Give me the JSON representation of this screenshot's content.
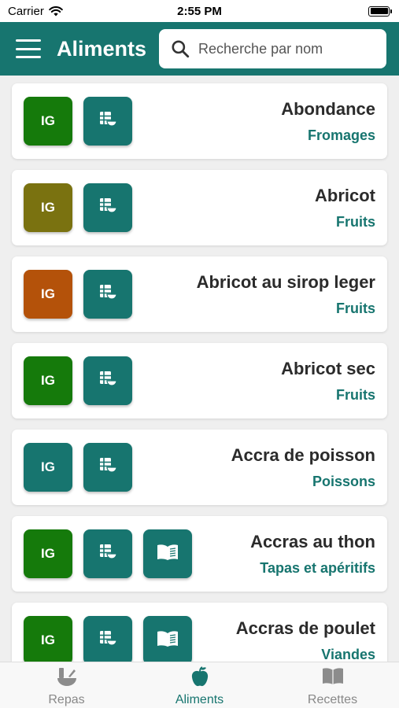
{
  "status": {
    "carrier": "Carrier",
    "time": "2:55 PM"
  },
  "header": {
    "title": "Aliments",
    "search_placeholder": "Recherche par nom"
  },
  "colors": {
    "primary": "#17756f",
    "ig_green": "#157a0b",
    "ig_olive": "#7a7210",
    "ig_orange": "#b4520a"
  },
  "items": [
    {
      "name": "Abondance",
      "category": "Fromages",
      "ig_label": "IG",
      "ig_color": "#157a0b",
      "has_recipe": false
    },
    {
      "name": "Abricot",
      "category": "Fruits",
      "ig_label": "IG",
      "ig_color": "#7a7210",
      "has_recipe": false
    },
    {
      "name": "Abricot au sirop leger",
      "category": "Fruits",
      "ig_label": "IG",
      "ig_color": "#b4520a",
      "has_recipe": false
    },
    {
      "name": "Abricot sec",
      "category": "Fruits",
      "ig_label": "IG",
      "ig_color": "#157a0b",
      "has_recipe": false
    },
    {
      "name": "Accra de poisson",
      "category": "Poissons",
      "ig_label": "IG",
      "ig_color": "#17756f",
      "has_recipe": false
    },
    {
      "name": "Accras au thon",
      "category": "Tapas et apéritifs",
      "ig_label": "IG",
      "ig_color": "#157a0b",
      "has_recipe": true
    },
    {
      "name": "Accras de poulet",
      "category": "Viandes",
      "ig_label": "IG",
      "ig_color": "#157a0b",
      "has_recipe": true
    }
  ],
  "tabs": [
    {
      "label": "Repas",
      "icon": "mortar-pestle-icon",
      "active": false
    },
    {
      "label": "Aliments",
      "icon": "apple-icon",
      "active": true
    },
    {
      "label": "Recettes",
      "icon": "book-icon",
      "active": false
    }
  ]
}
